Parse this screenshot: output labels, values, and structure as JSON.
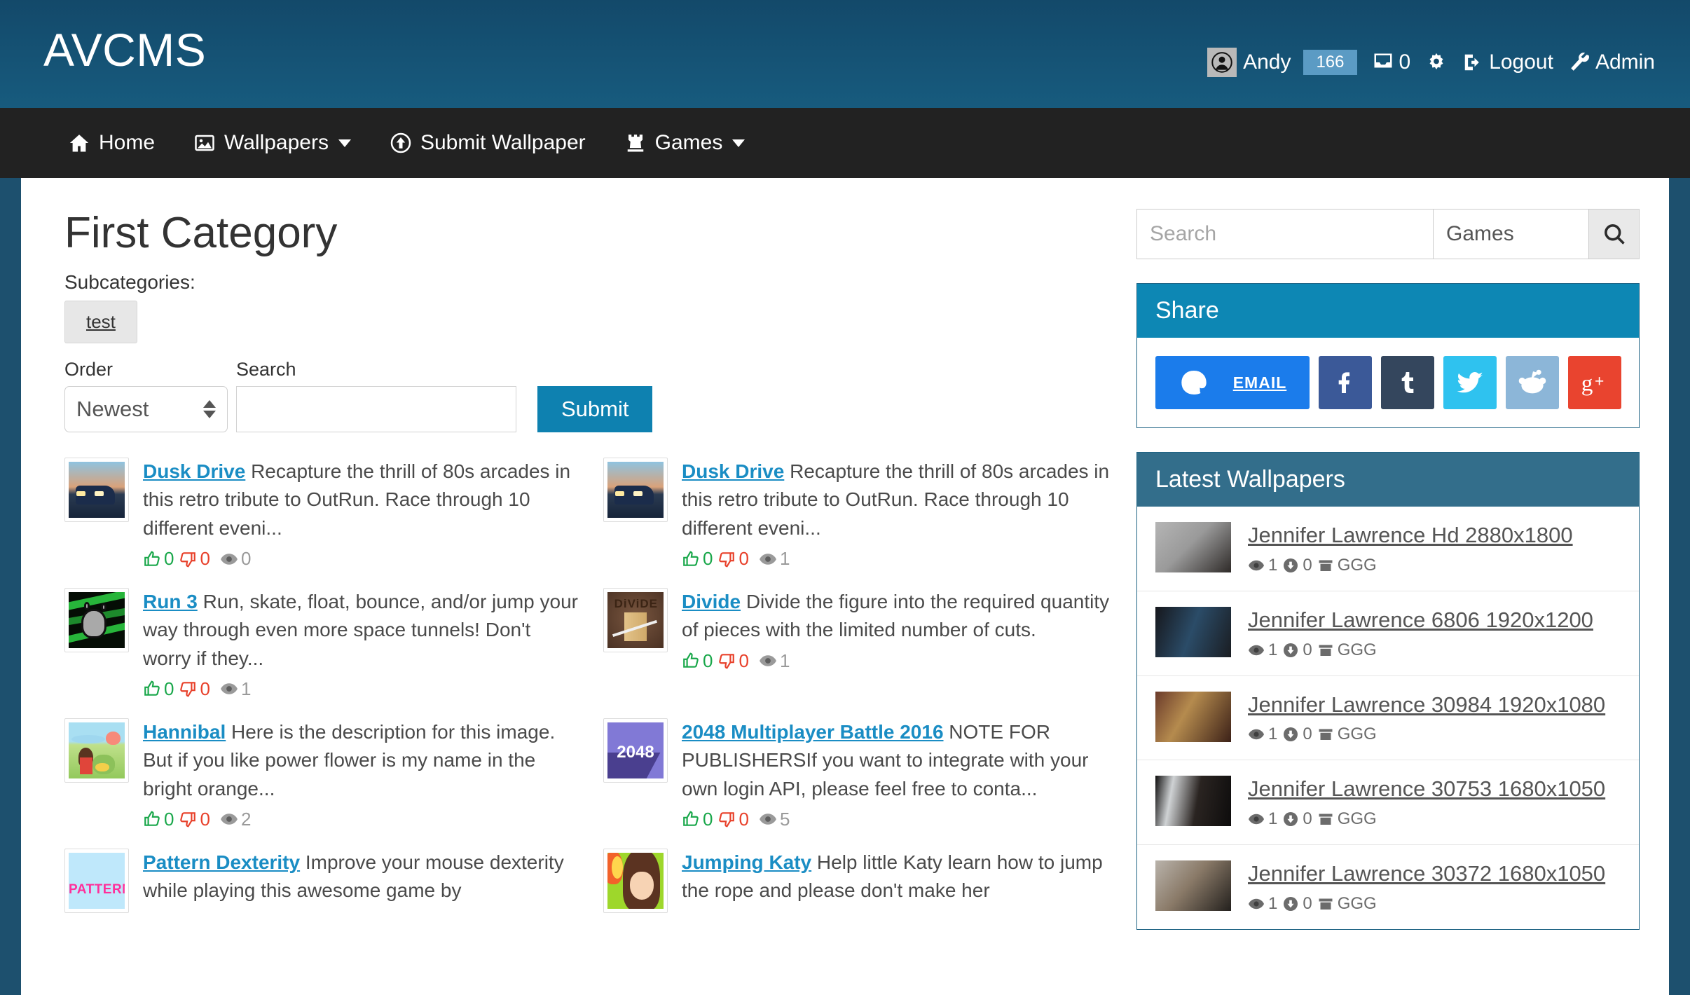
{
  "header": {
    "brand": "AVCMS",
    "user": {
      "name": "Andy",
      "points": "166"
    },
    "inbox_count": "0",
    "logout_label": "Logout",
    "admin_label": "Admin",
    "colors": {
      "masthead": "#13496a",
      "navbar": "#222222",
      "accent": "#0e81b0"
    }
  },
  "nav": {
    "items": [
      {
        "label": "Home",
        "icon": "home-icon",
        "caret": false
      },
      {
        "label": "Wallpapers",
        "icon": "image-icon",
        "caret": true
      },
      {
        "label": "Submit Wallpaper",
        "icon": "arrow-up-circle-icon",
        "caret": false
      },
      {
        "label": "Games",
        "icon": "chess-rook-icon",
        "caret": true
      }
    ]
  },
  "main": {
    "title": "First Category",
    "subcategories_label": "Subcategories:",
    "subcategories": [
      "test"
    ],
    "filter": {
      "order_label": "Order",
      "order_value": "Newest",
      "search_label": "Search",
      "search_value": "",
      "search_placeholder": "",
      "submit_label": "Submit"
    },
    "games": [
      {
        "title": "Dusk Drive",
        "description": "Recapture the thrill of 80s arcades in this retro tribute to OutRun. Race through 10 different eveni...",
        "likes": "0",
        "dislikes": "0",
        "views": "0",
        "thumb": "dusk-drive-thumb"
      },
      {
        "title": "Dusk Drive",
        "description": "Recapture the thrill of 80s arcades in this retro tribute to OutRun. Race through 10 different eveni...",
        "likes": "0",
        "dislikes": "0",
        "views": "1",
        "thumb": "dusk-drive-thumb"
      },
      {
        "title": "Run 3",
        "description": "Run, skate, float, bounce, and/or jump your way through even more space tunnels! Don't worry if they...",
        "likes": "0",
        "dislikes": "0",
        "views": "1",
        "thumb": "run-3-thumb"
      },
      {
        "title": "Divide",
        "description": "Divide the figure into the required quantity of pieces with the limited number of cuts.",
        "likes": "0",
        "dislikes": "0",
        "views": "1",
        "thumb": "divide-thumb"
      },
      {
        "title": "Hannibal",
        "description": "Here is the description for this image. But if you like power flower is my name in the bright orange...",
        "likes": "0",
        "dislikes": "0",
        "views": "2",
        "thumb": "hannibal-thumb"
      },
      {
        "title": "2048 Multiplayer Battle 2016",
        "description": "NOTE FOR PUBLISHERSIf you want to integrate with your own login API, please feel free to conta...",
        "likes": "0",
        "dislikes": "0",
        "views": "5",
        "thumb": "2048-thumb"
      },
      {
        "title": "Pattern Dexterity",
        "description": "Improve your mouse dexterity while playing this awesome game by",
        "likes": "",
        "dislikes": "",
        "views": "",
        "thumb": "pattern-dexterity-thumb"
      },
      {
        "title": "Jumping Katy",
        "description": "Help little Katy learn how to jump the rope and please don't make her",
        "likes": "",
        "dislikes": "",
        "views": "",
        "thumb": "jumping-katy-thumb"
      }
    ]
  },
  "sidebar": {
    "search": {
      "placeholder": "Search",
      "value": "",
      "scope_value": "Games",
      "button_icon": "search-icon"
    },
    "share": {
      "heading": "Share",
      "buttons": [
        {
          "label": "EMAIL",
          "icon": "at-icon",
          "color": "#1b7ceb"
        },
        {
          "label": "",
          "icon": "facebook-icon",
          "color": "#3b5998"
        },
        {
          "label": "",
          "icon": "tumblr-icon",
          "color": "#34465d"
        },
        {
          "label": "",
          "icon": "twitter-icon",
          "color": "#2fc2ef"
        },
        {
          "label": "",
          "icon": "reddit-icon",
          "color": "#8cb6d8"
        },
        {
          "label": "",
          "icon": "googleplus-icon",
          "color": "#e9442f"
        }
      ]
    },
    "latest": {
      "heading": "Latest Wallpapers",
      "items": [
        {
          "title": "Jennifer Lawrence Hd 2880x1800",
          "views": "1",
          "downloads": "0",
          "category": "GGG",
          "thumb": "jl-1"
        },
        {
          "title": "Jennifer Lawrence 6806 1920x1200",
          "views": "1",
          "downloads": "0",
          "category": "GGG",
          "thumb": "jl-2"
        },
        {
          "title": "Jennifer Lawrence 30984 1920x1080",
          "views": "1",
          "downloads": "0",
          "category": "GGG",
          "thumb": "jl-3"
        },
        {
          "title": "Jennifer Lawrence 30753 1680x1050",
          "views": "1",
          "downloads": "0",
          "category": "GGG",
          "thumb": "jl-4"
        },
        {
          "title": "Jennifer Lawrence 30372 1680x1050",
          "views": "1",
          "downloads": "0",
          "category": "GGG",
          "thumb": "jl-5"
        }
      ]
    }
  }
}
